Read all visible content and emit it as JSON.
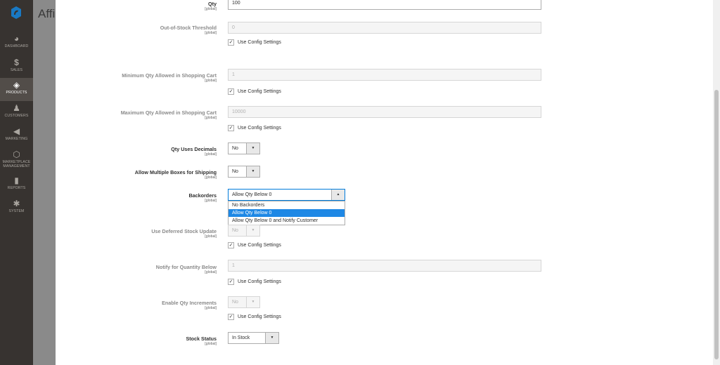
{
  "backdrop": {
    "title": "Affiliate Products"
  },
  "sidebar": {
    "items": [
      {
        "label": "Dashboard",
        "icon": "dashboard-icon",
        "glyph": "◕"
      },
      {
        "label": "Sales",
        "icon": "dollar-icon",
        "glyph": "$"
      },
      {
        "label": "Products",
        "icon": "box-icon",
        "glyph": "◈",
        "active": true
      },
      {
        "label": "Customers",
        "icon": "person-icon",
        "glyph": "♟"
      },
      {
        "label": "Marketing",
        "icon": "megaphone-icon",
        "glyph": "◀"
      },
      {
        "label": "Marketplace Management",
        "icon": "hexagon-icon",
        "glyph": "⬡"
      },
      {
        "label": "Reports",
        "icon": "bar-chart-icon",
        "glyph": "▮"
      },
      {
        "label": "System",
        "icon": "gear-icon",
        "glyph": "✱"
      }
    ]
  },
  "scope_text": "[global]",
  "use_config_label": "Use Config Settings",
  "fields": {
    "qty": {
      "label": "Qty",
      "value": "100"
    },
    "out_of_stock_threshold": {
      "label": "Out-of-Stock Threshold",
      "value": "0",
      "use_config": true
    },
    "min_qty_cart": {
      "label": "Minimum Qty Allowed in Shopping Cart",
      "value": "1",
      "use_config": true
    },
    "max_qty_cart": {
      "label": "Maximum Qty Allowed in Shopping Cart",
      "value": "10000",
      "use_config": true
    },
    "qty_uses_decimals": {
      "label": "Qty Uses Decimals",
      "value": "No"
    },
    "multiple_boxes": {
      "label": "Allow Multiple Boxes for Shipping",
      "value": "No"
    },
    "backorders": {
      "label": "Backorders",
      "value": "Allow Qty Below 0",
      "options": [
        "No Backorders",
        "Allow Qty Below 0",
        "Allow Qty Below 0 and Notify Customer"
      ],
      "selected_index": 1
    },
    "deferred_stock": {
      "label": "Use Deferred Stock Update",
      "value": "No",
      "use_config": true
    },
    "notify_qty_below": {
      "label": "Notify for Quantity Below",
      "value": "1",
      "use_config": true
    },
    "enable_qty_increments": {
      "label": "Enable Qty Increments",
      "value": "No",
      "use_config": true
    },
    "stock_status": {
      "label": "Stock Status",
      "value": "In Stock"
    }
  },
  "colors": {
    "sidebar_bg": "#373330",
    "active_nav_bg": "#524d49",
    "selected_option": "#1e88e5"
  }
}
